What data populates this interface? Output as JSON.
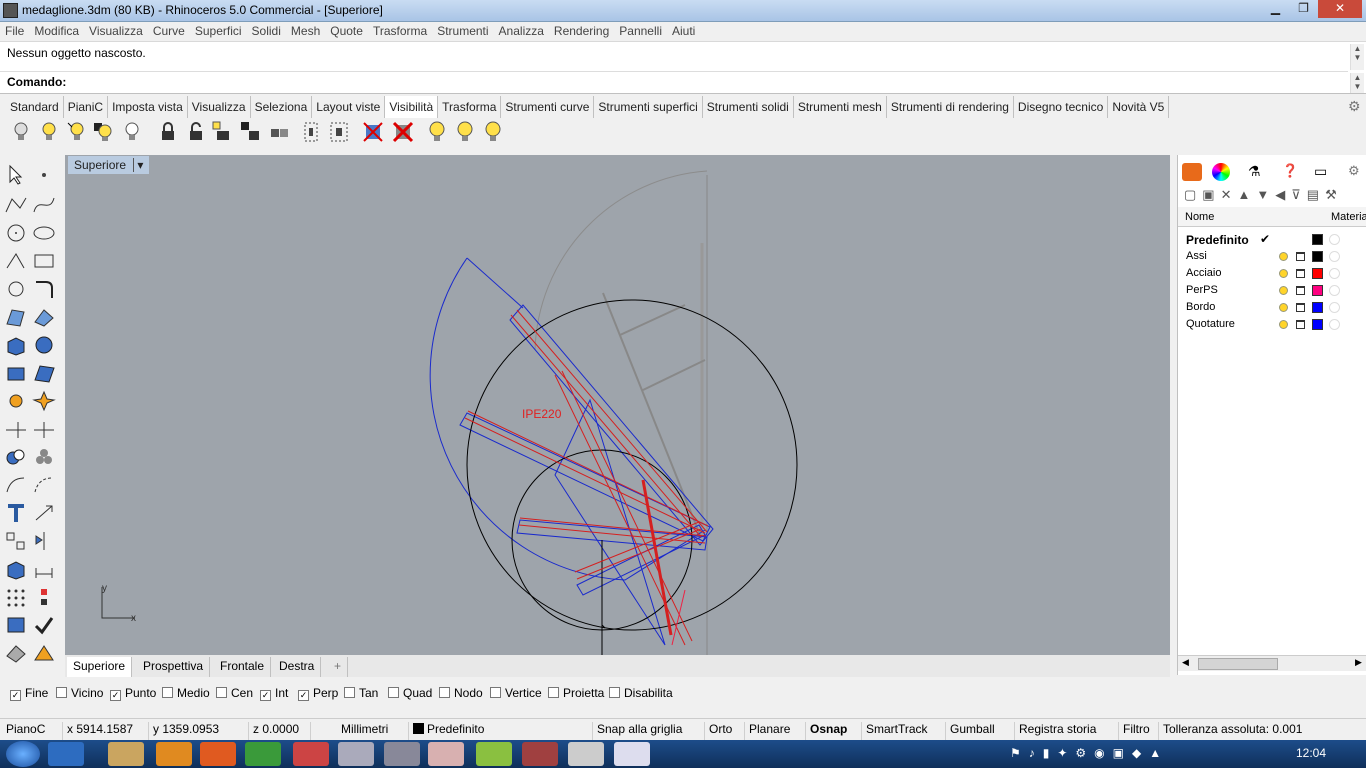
{
  "window": {
    "title": "medaglione.3dm (80 KB) - Rhinoceros 5.0 Commercial - [Superiore]"
  },
  "menu": [
    "File",
    "Modifica",
    "Visualizza",
    "Curve",
    "Superfici",
    "Solidi",
    "Mesh",
    "Quote",
    "Trasforma",
    "Strumenti",
    "Analizza",
    "Rendering",
    "Pannelli",
    "Aiuti"
  ],
  "history": {
    "last_message": "Nessun oggetto nascosto.",
    "command_label": "Comando:"
  },
  "toolbar_tabs": [
    "Standard",
    "PianiC",
    "Imposta vista",
    "Visualizza",
    "Seleziona",
    "Layout viste",
    "Visibilità",
    "Trasforma",
    "Strumenti curve",
    "Strumenti superfici",
    "Strumenti solidi",
    "Strumenti mesh",
    "Strumenti di rendering",
    "Disegno tecnico",
    "Novità V5"
  ],
  "viewport": {
    "title": "Superiore",
    "annotation": "IPE220",
    "axis_y": "y",
    "axis_x": "x"
  },
  "viewport_tabs": [
    "Superiore",
    "Prospettiva",
    "Frontale",
    "Destra",
    "+"
  ],
  "layers_panel": {
    "header_name": "Nome",
    "header_material": "Materia",
    "layers": [
      {
        "name": "Predefinito",
        "current": true,
        "color": "#000000"
      },
      {
        "name": "Assi",
        "current": false,
        "color": "#000000"
      },
      {
        "name": "Acciaio",
        "current": false,
        "color": "#ff0000"
      },
      {
        "name": "PerPS",
        "current": false,
        "color": "#ff0080"
      },
      {
        "name": "Bordo",
        "current": false,
        "color": "#0000ff"
      },
      {
        "name": "Quotature",
        "current": false,
        "color": "#0000ff"
      }
    ],
    "current_mark": "✔"
  },
  "osnap": [
    {
      "label": "Fine",
      "checked": true
    },
    {
      "label": "Vicino",
      "checked": false
    },
    {
      "label": "Punto",
      "checked": true
    },
    {
      "label": "Medio",
      "checked": false
    },
    {
      "label": "Cen",
      "checked": false
    },
    {
      "label": "Int",
      "checked": true
    },
    {
      "label": "Perp",
      "checked": true
    },
    {
      "label": "Tan",
      "checked": false
    },
    {
      "label": "Quad",
      "checked": false
    },
    {
      "label": "Nodo",
      "checked": false
    },
    {
      "label": "Vertice",
      "checked": false
    },
    {
      "label": "Proietta",
      "checked": false
    },
    {
      "label": "Disabilita",
      "checked": false
    }
  ],
  "status": {
    "cplane": "PianoC",
    "x": "x 5914.1587",
    "y": "y 1359.0953",
    "z": "z 0.0000",
    "units": "Millimetri",
    "layer": "Predefinito",
    "grid_snap": "Snap alla griglia",
    "ortho": "Orto",
    "planar": "Planare",
    "osnap": "Osnap",
    "smarttrack": "SmartTrack",
    "gumball": "Gumball",
    "history": "Registra storia",
    "filter": "Filtro",
    "tolerance": "Tolleranza assoluta: 0.001"
  },
  "taskbar": {
    "clock": "12:04"
  }
}
